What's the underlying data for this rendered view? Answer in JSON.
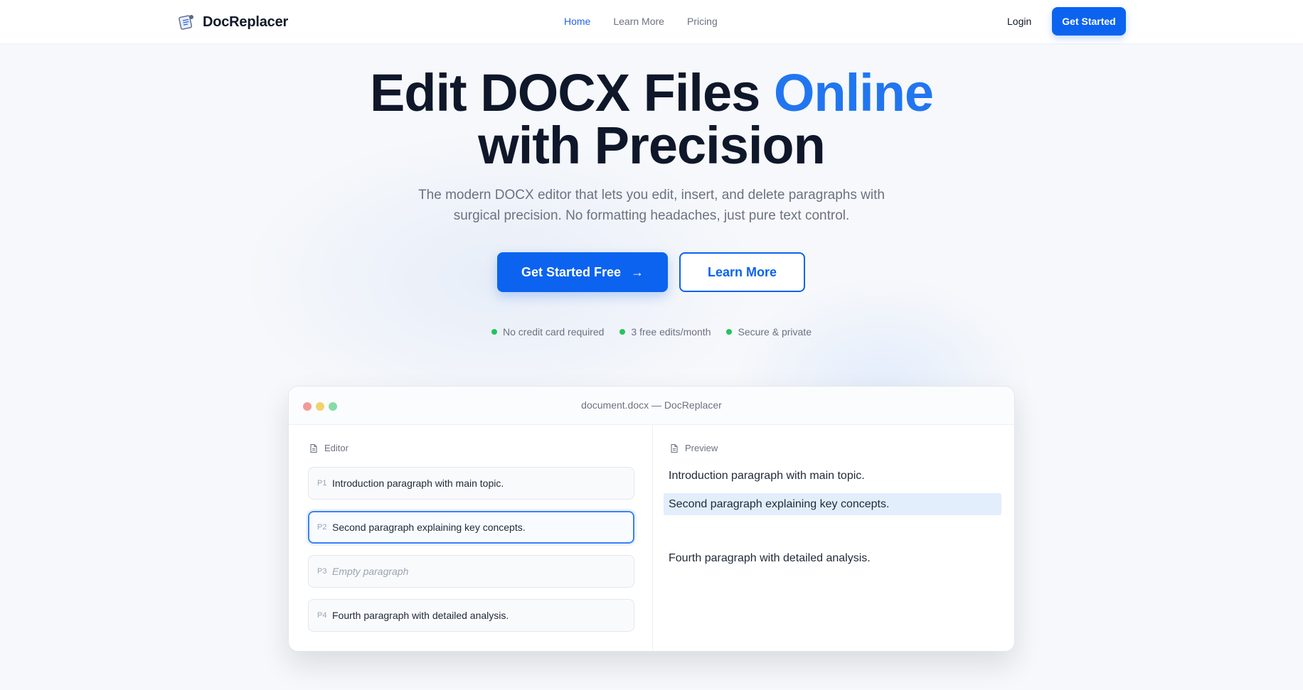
{
  "nav": {
    "brand": "DocReplacer",
    "links": [
      "Home",
      "Learn More",
      "Pricing"
    ],
    "login": "Login",
    "cta": "Get Started"
  },
  "hero": {
    "title_part1": "Edit DOCX Files ",
    "title_accent": "Online",
    "title_part2": "with Precision",
    "subtitle": "The modern DOCX editor that lets you edit, insert, and delete paragraphs with surgical precision. No formatting headaches, just pure text control.",
    "primary_button": "Get Started Free",
    "secondary_button": "Learn More",
    "perks": [
      "No credit card required",
      "3 free edits/month",
      "Secure & private"
    ]
  },
  "window": {
    "title": "document.docx — DocReplacer",
    "editor_label": "Editor",
    "preview_label": "Preview",
    "paragraphs": [
      {
        "num": "P1",
        "text": "Introduction paragraph with main topic."
      },
      {
        "num": "P2",
        "text": "Second paragraph explaining key concepts."
      },
      {
        "num": "P3",
        "text": "Empty paragraph"
      },
      {
        "num": "P4",
        "text": "Fourth paragraph with detailed analysis."
      }
    ],
    "preview": [
      "Introduction paragraph with main topic.",
      "Second paragraph explaining key concepts.",
      "Fourth paragraph with detailed analysis."
    ]
  },
  "colors": {
    "accent": "#0b63f0",
    "title_accent": "#2176f0",
    "success": "#22c55e"
  }
}
